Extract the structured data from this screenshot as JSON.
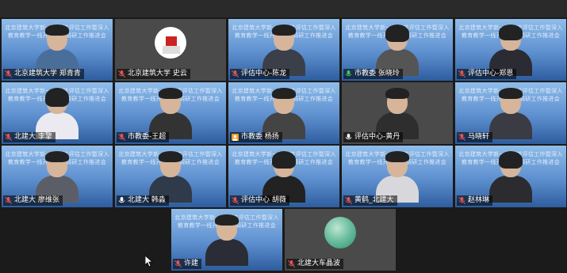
{
  "banner_text": "北京建筑大学新一轮审核评估工作暨深入教育教学一线开展学年调研工作推进会",
  "tiles": [
    {
      "name": "北京建筑大学 郑青青",
      "mic": "muted"
    },
    {
      "name": "北京建筑大学 史云",
      "mic": "muted"
    },
    {
      "name": "评估中心-陈龙",
      "mic": "muted"
    },
    {
      "name": "市教委 张晓玲",
      "mic": "speaking"
    },
    {
      "name": "评估中心-郑恩",
      "mic": "muted"
    },
    {
      "name": "北建大 李擎",
      "mic": "muted"
    },
    {
      "name": "市教委-王超",
      "mic": "muted"
    },
    {
      "name": "市教委 杨扬",
      "mic": "avatar"
    },
    {
      "name": "评估中心-黄丹",
      "mic": "on"
    },
    {
      "name": "马晓轩",
      "mic": "muted"
    },
    {
      "name": "北建大 廖维张",
      "mic": "muted"
    },
    {
      "name": "北建大 韩淼",
      "mic": "on"
    },
    {
      "name": "评估中心 胡薇",
      "mic": "muted"
    },
    {
      "name": "黄鹤_北建大",
      "mic": "muted"
    },
    {
      "name": "赵林琳",
      "mic": "muted"
    },
    {
      "name": "许建",
      "mic": "muted"
    },
    {
      "name": "北建大车晶波",
      "mic": "muted"
    }
  ],
  "colors": {
    "muted": "#e05555",
    "on": "#ffffff",
    "speaking": "#3fcf5a",
    "avatar": "#f0a020"
  }
}
